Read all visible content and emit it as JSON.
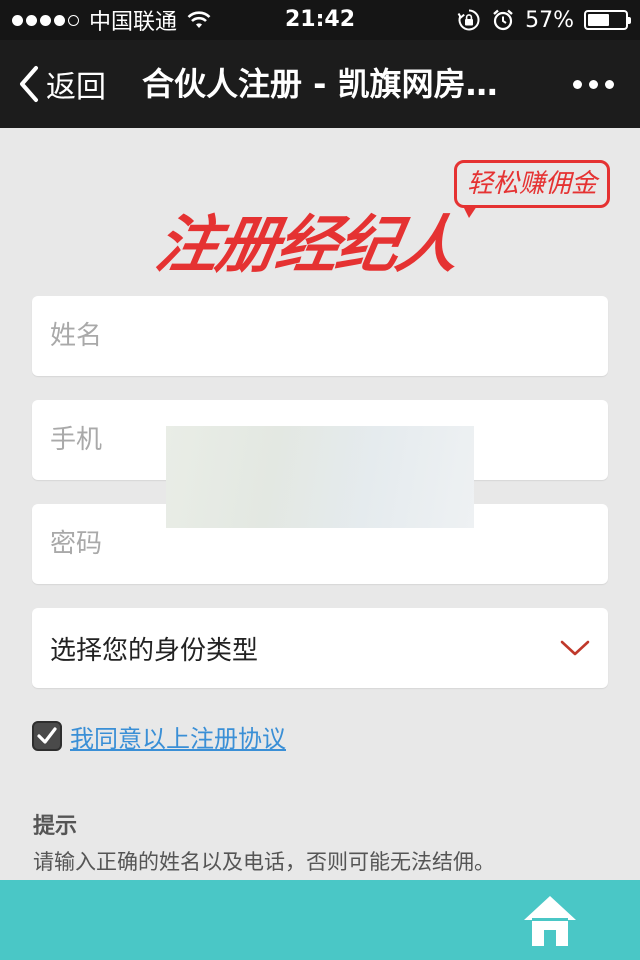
{
  "status_bar": {
    "carrier": "中国联通",
    "time": "21:42",
    "battery_percent_label": "57%",
    "battery_level": 0.57
  },
  "nav": {
    "back_label": "返回",
    "title": "合伙人注册 - 凯旗网房…"
  },
  "logo": {
    "main_text": "注册经纪人",
    "bubble_text": "轻松赚佣金"
  },
  "form": {
    "name_placeholder": "姓名",
    "phone_placeholder": "手机",
    "password_placeholder": "密码",
    "identity_select_label": "选择您的身份类型"
  },
  "agreement": {
    "checked": true,
    "link_text": "我同意以上注册协议"
  },
  "tips": {
    "title": "提示",
    "text": "请输入正确的姓名以及电话，否则可能无法结佣。"
  },
  "colors": {
    "accent_red": "#e53232",
    "bottom_bar": "#4ac7c6",
    "link_blue": "#3a8fd6"
  },
  "icons": {
    "back": "chevron-left-icon",
    "more": "more-dots-icon",
    "select": "chevron-down-icon",
    "check": "check-icon",
    "home": "home-icon"
  }
}
